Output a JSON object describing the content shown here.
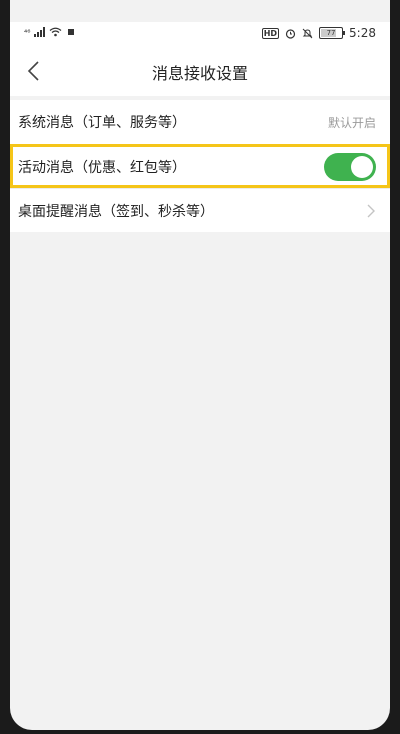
{
  "status_bar": {
    "signal_text": "⁴⁶",
    "hd_badge": "HD",
    "battery_level": "77",
    "time": "5:28"
  },
  "header": {
    "title": "消息接收设置"
  },
  "settings": [
    {
      "label": "系统消息（订单、服务等）",
      "value": "默认开启"
    },
    {
      "label": "活动消息（优惠、红包等）",
      "toggle_on": true
    },
    {
      "label": "桌面提醒消息（签到、秒杀等）"
    }
  ],
  "colors": {
    "toggle_on": "#3fb24f",
    "highlight": "#f5c518"
  },
  "icons": {
    "back": "chevron-left-icon",
    "chevron": "chevron-right-icon",
    "wifi": "wifi-icon",
    "signal": "signal-icon",
    "alarm": "alarm-icon",
    "silent": "silent-icon",
    "battery": "battery-icon"
  }
}
